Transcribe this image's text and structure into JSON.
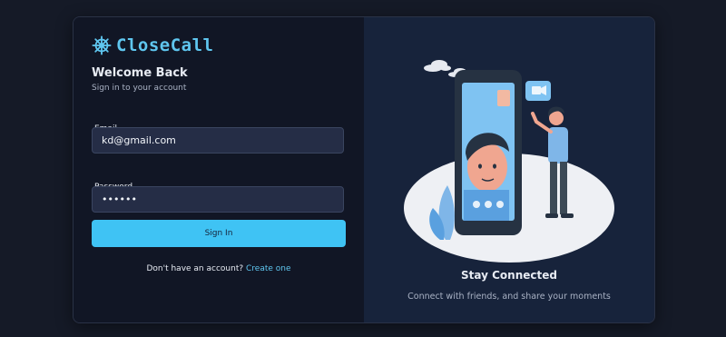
{
  "brand": {
    "name": "CloseCall",
    "icon": "ship-wheel-icon",
    "color": "#5fc6ef"
  },
  "login": {
    "heading": "Welcome Back",
    "subheading": "Sign in to your account",
    "email_label": "Email",
    "email_value": "kd@gmail.com",
    "password_label": "Password",
    "password_value": "kd@pas",
    "submit_label": "Sign In",
    "signup_prompt": "Don't have an account?",
    "signup_link": "Create one"
  },
  "promo": {
    "title": "Stay Connected",
    "description": "Connect with friends, and share your moments"
  },
  "colors": {
    "accent": "#3fc3f4",
    "page_bg": "#151a27",
    "left_panel": "#111625",
    "right_panel": "#17233b",
    "input_bg": "#252d46"
  }
}
